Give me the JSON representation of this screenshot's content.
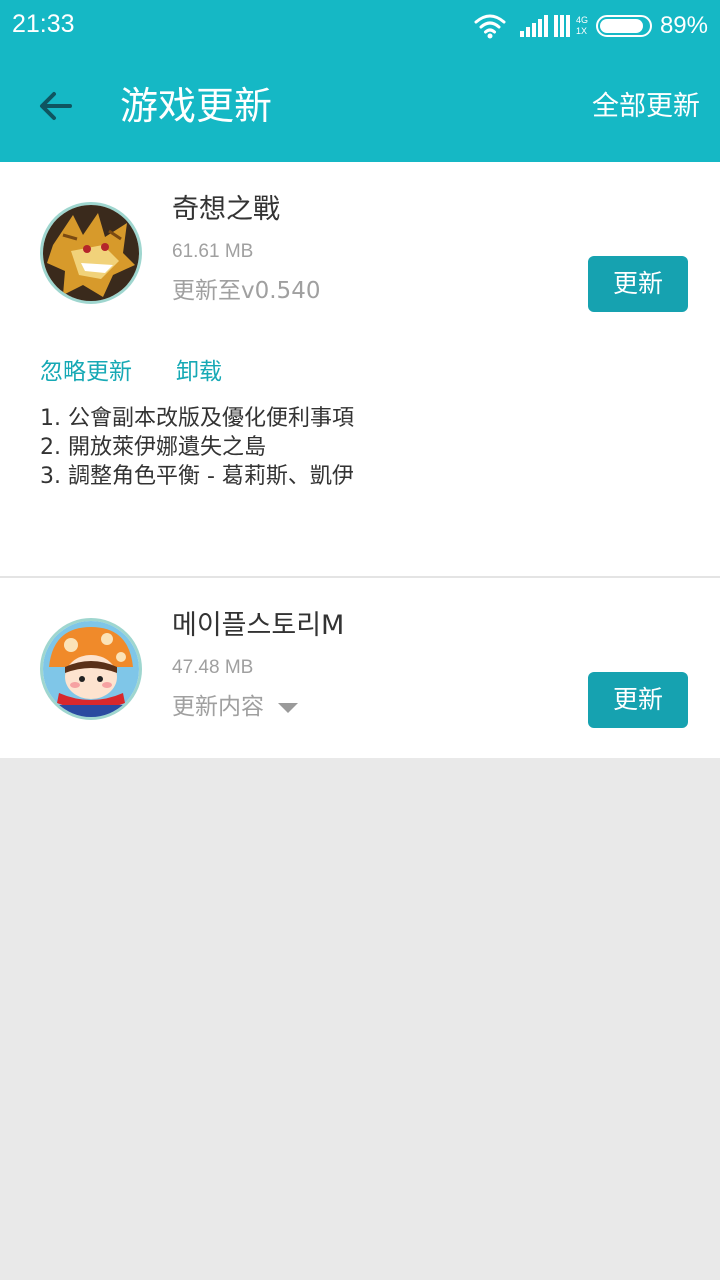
{
  "status_bar": {
    "time": "21:33",
    "network_top": "4G",
    "network_bottom": "1X",
    "battery_percent": "89%",
    "battery_level": 0.89
  },
  "app_bar": {
    "title": "游戏更新",
    "update_all_label": "全部更新",
    "back_icon": "arrow-left-icon"
  },
  "updates": [
    {
      "name": "奇想之戰",
      "size": "61.61 MB",
      "version": "更新至v0.540",
      "button_label": "更新",
      "ignore_label": "忽略更新",
      "uninstall_label": "卸载",
      "notes": [
        "1. 公會副本改版及優化便利事項",
        "2. 開放萊伊娜遺失之島",
        "3. 調整角色平衡 - 葛莉斯、凱伊"
      ]
    },
    {
      "name": "메이플스토리M",
      "size": "47.48 MB",
      "details_label": "更新内容",
      "button_label": "更新"
    }
  ],
  "colors": {
    "primary": "#15b8c5",
    "button": "#16a2b0",
    "link": "#16a9b5",
    "background": "#e9e9e9"
  }
}
